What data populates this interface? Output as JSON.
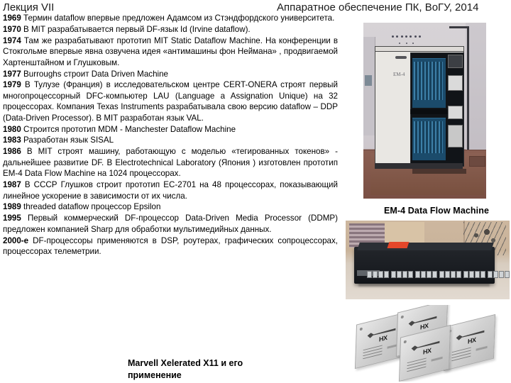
{
  "header": {
    "left_title": "Лекция VII",
    "right_title": "Аппаратное обеспечение ПК, ВоГУ, 2014"
  },
  "timeline": [
    {
      "year": "1969",
      "text": "Термин dataflow впервые предложен Адамсом из Стэндфордского университета."
    },
    {
      "year": "1970",
      "text": "В MIT разрабатывается первый DF-язык Id (Irvine dataflow)."
    },
    {
      "year": "1974",
      "text": "Там же разрабатывают прототип MIT Static Dataflow Machine. На конференции в Стокгольме впервые явна озвучена идея «антимашины фон Неймана» , продвигаемой Хартенштайном и Глушковым."
    },
    {
      "year": "1977",
      "text": "Burroughs строит Data Driven Machine"
    },
    {
      "year": "1979",
      "text": "В Тулузе (Франция) в исследовательском центре CERT-ONERA строят первый многопроцессорный DFC-компьютер LAU (Language a Assignation Unique) на 32 процессорах. Компания Texas Instruments разрабатывала свою версию dataflow – DDP (Data-Driven Processor). В MIT разработан язык VAL."
    },
    {
      "year": "1980",
      "text": "Строится прототип MDM - Manchester Dataflow Machine"
    },
    {
      "year": "1983",
      "text": "Разработан язык SISAL"
    },
    {
      "year": "1986",
      "text": "В MIT строят машину, работающую с моделью «тегированных токенов»  - дальнейшее развитие DF. В Electrotechnical Laboratory (Япония ) изготовлен прототип EM-4 Data Flow Machine на 1024 процессорах."
    },
    {
      "year": "1987",
      "text": "В СССР Глушков строит прототип  ЕС-2701 на 48 процессорах, показывающий линейное ускорение в зависимости от их числа."
    },
    {
      "year": "1989",
      "text": "threaded dataflow  процессор Epsilon"
    },
    {
      "year": "1995",
      "text": "Первый коммерческий DF-процессор Data-Driven Media Processor (DDMP) предложен компанией Sharp для обработки мультимедийных данных."
    },
    {
      "year": "2000-е",
      "text": "DF-процессоры применяются в DSP, роутерах, графических сопроцессорах, процессорах телеметрии."
    }
  ],
  "bottom_caption": "Marvell Xelerated X11 и его применение",
  "figures": {
    "em4": {
      "caption": "EM-4 Data Flow Machine",
      "alt": "photo-em4-data-flow-machine-cabinet"
    },
    "switch": {
      "alt": "photo-network-switch-appliance"
    },
    "chips": {
      "alt": "photo-marvell-xelerated-hx-chips",
      "chip_label": "HX"
    }
  },
  "colors": {
    "text": "#000000",
    "header": "#1a1a1a",
    "background": "#ffffff",
    "sticker_red": "#e4472a",
    "rack_blue": "#1b4b6b"
  }
}
